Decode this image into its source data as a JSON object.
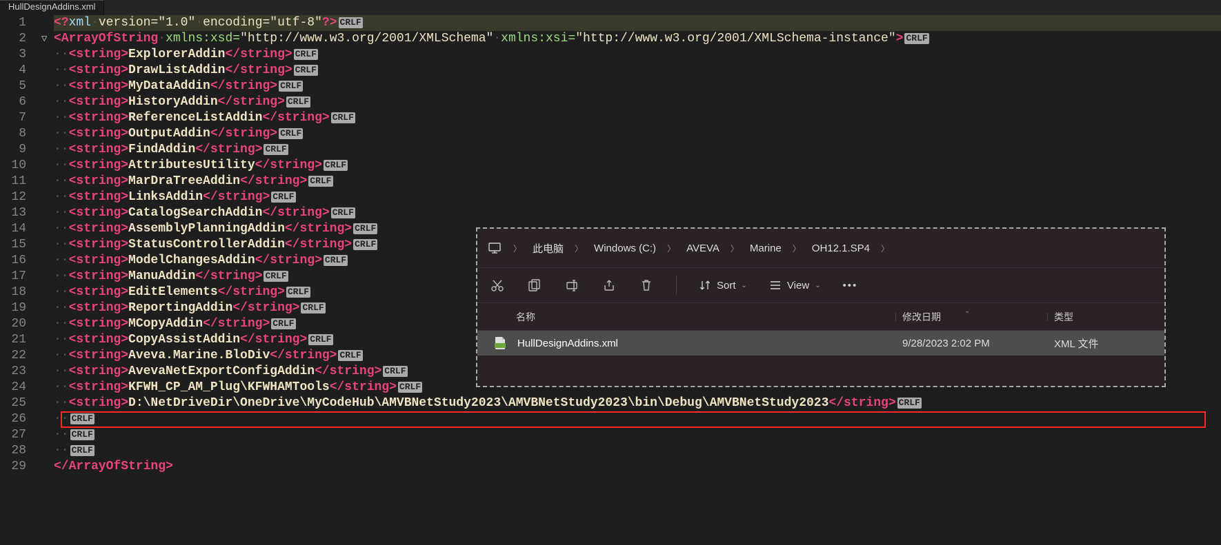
{
  "tab": {
    "title": "HullDesignAddins.xml"
  },
  "crlf": "CRLF",
  "code": {
    "xml_decl": {
      "version_attr": "version",
      "version_val": "\"1.0\"",
      "encoding_attr": "encoding",
      "encoding_val": "\"utf-8\""
    },
    "root": {
      "open": "ArrayOfString",
      "xmlns_xsd_attr": "xmlns:xsd",
      "xmlns_xsd_val": "\"http://www.w3.org/2001/XMLSchema\"",
      "xmlns_xsi_attr": "xmlns:xsi",
      "xmlns_xsi_val": "\"http://www.w3.org/2001/XMLSchema-instance\""
    },
    "string_tag": "string",
    "items": [
      "ExplorerAddin",
      "DrawListAddin",
      "MyDataAddin",
      "HistoryAddin",
      "ReferenceListAddin",
      "OutputAddin",
      "FindAddin",
      "AttributesUtility",
      "MarDraTreeAddin",
      "LinksAddin",
      "CatalogSearchAddin",
      "AssemblyPlanningAddin",
      "StatusControllerAddin",
      "ModelChangesAddin",
      "ManuAddin",
      "EditElements",
      "ReportingAddin",
      "MCopyAddin",
      "CopyAssistAddin",
      "Aveva.Marine.BloDiv",
      "AvevaNetExportConfigAddin",
      "KFWH_CP_AM_Plug\\KFWHAMTools",
      "D:\\NetDriveDir\\OneDrive\\MyCodeHub\\AMVBNetStudy2023\\AMVBNetStudy2023\\bin\\Debug\\AMVBNetStudy2023"
    ],
    "close": "ArrayOfString"
  },
  "explorer": {
    "breadcrumb": [
      "此电脑",
      "Windows (C:)",
      "AVEVA",
      "Marine",
      "OH12.1.SP4"
    ],
    "toolbar": {
      "sort": "Sort",
      "view": "View"
    },
    "headers": {
      "name": "名称",
      "date": "修改日期",
      "type": "类型"
    },
    "file": {
      "name": "HullDesignAddins.xml",
      "date": "9/28/2023 2:02 PM",
      "type": "XML 文件"
    }
  }
}
